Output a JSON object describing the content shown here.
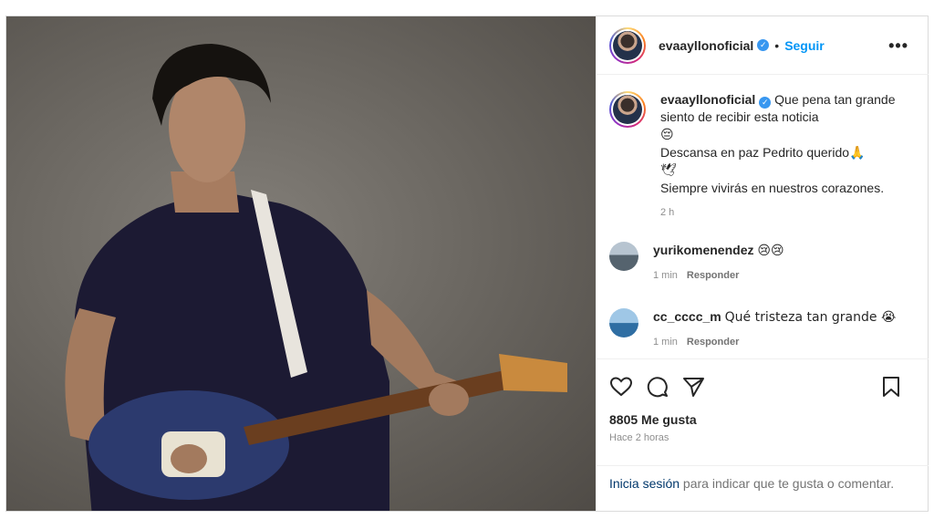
{
  "post": {
    "author": "evaayllonoficial",
    "follow_label": "Seguir",
    "dot": "•",
    "more_label": "•••",
    "verified_glyph": "✓",
    "caption": {
      "author": "evaayllonoficial",
      "line1": "Que pena tan grande siento de recibir esta noticia",
      "emoji1": "😔",
      "line2": "Descansa en paz Pedrito querido🙏",
      "emoji2": "🕊",
      "line3": "Siempre vivirás en nuestros corazones.",
      "time": "2 h"
    },
    "comments": [
      {
        "user": "yurikomenendez",
        "text": "😢😢",
        "time": "1 min",
        "reply_label": "Responder"
      },
      {
        "user": "cc_cccc_m",
        "text": "Qué tristeza tan grande 😭",
        "time": "1 min",
        "reply_label": "Responder"
      }
    ],
    "likes": "8805 Me gusta",
    "posted_ago": "Hace 2 horas",
    "login_link": "Inicia sesión",
    "login_text": " para indicar que te gusta o comentar.",
    "icons": {
      "like": "heart-icon",
      "comment": "comment-icon",
      "share": "share-icon",
      "save": "bookmark-icon",
      "verified": "verified-badge-icon"
    }
  }
}
